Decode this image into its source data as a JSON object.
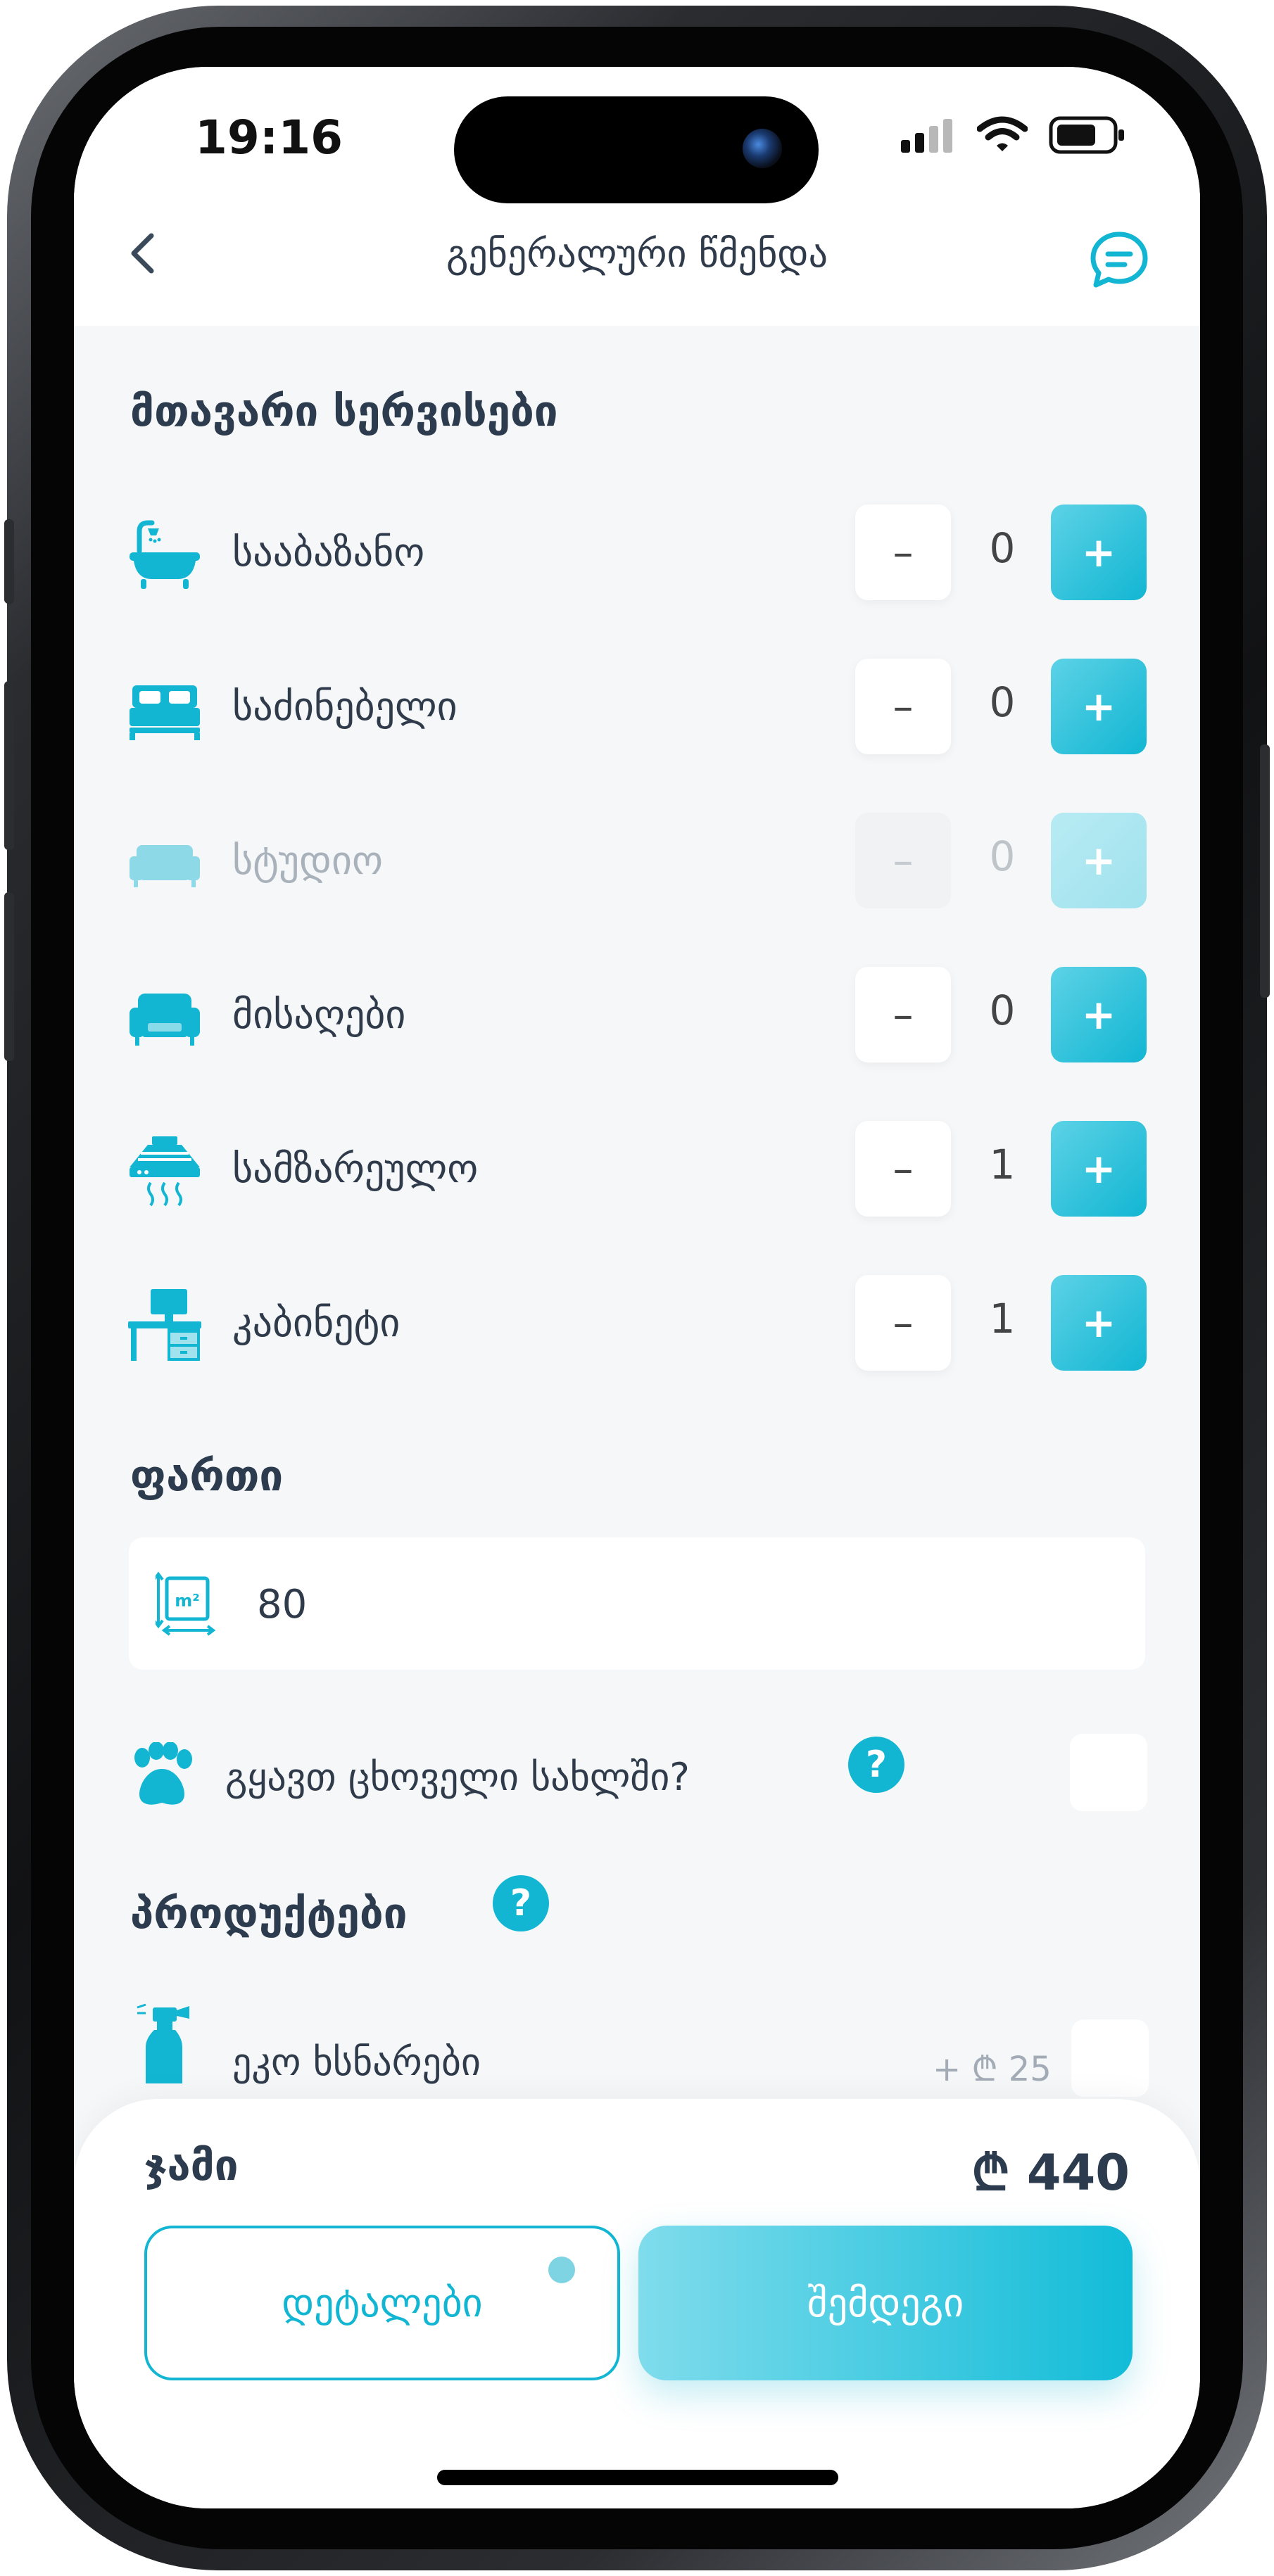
{
  "status_bar": {
    "time": "19:16"
  },
  "nav": {
    "title": "გენერალური წმენდა"
  },
  "main_services": {
    "title": "მთავარი სერვისები",
    "items": [
      {
        "label": "სააბაზანო",
        "value": "0",
        "icon": "bathtub-icon",
        "enabled": true
      },
      {
        "label": "საძინებელი",
        "value": "0",
        "icon": "bed-icon",
        "enabled": true
      },
      {
        "label": "სტუდიო",
        "value": "0",
        "icon": "sofa-icon",
        "enabled": false
      },
      {
        "label": "მისაღები",
        "value": "0",
        "icon": "armchair-icon",
        "enabled": true
      },
      {
        "label": "სამზარეულო",
        "value": "1",
        "icon": "kitchen-hood-icon",
        "enabled": true
      },
      {
        "label": "კაბინეტი",
        "value": "1",
        "icon": "desk-icon",
        "enabled": true
      }
    ],
    "minus_label": "–",
    "plus_label": "+"
  },
  "area": {
    "title": "ფართი",
    "value": "80",
    "unit_icon": "area-m2-icon",
    "unit_text": "m²"
  },
  "pets": {
    "question": "გყავთ ცხოველი სახლში?",
    "help": "?",
    "checked": false
  },
  "products": {
    "title": "პროდუქტები",
    "help": "?",
    "items": [
      {
        "label": "ეკო ხსნარები",
        "price": "+ ₾ 25",
        "checked": false
      }
    ]
  },
  "summary": {
    "total_label": "ჯამი",
    "total_value": "₾ 440"
  },
  "actions": {
    "details_label": "დეტალები",
    "next_label": "შემდეგი"
  },
  "colors": {
    "accent": "#12b6d3",
    "accent_light": "#7fdcec",
    "text": "#2f3b4a"
  }
}
